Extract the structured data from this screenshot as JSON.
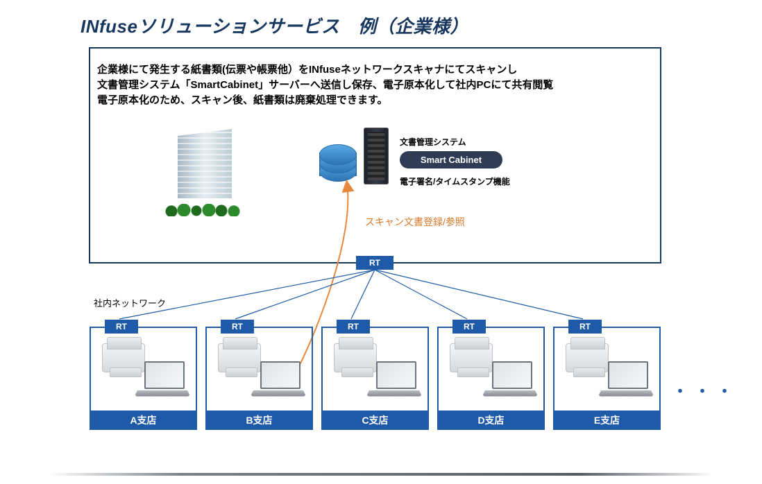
{
  "title": "INfuseソリューションサービス　例（企業様）",
  "description_line1": "企業様にて発生する紙書類(伝票や帳票他）をINfuseネットワークスキャナにてスキャンし",
  "description_line2": "文書管理システム「SmartCabinet」サーバーへ送信し保存、電子原本化して社内PCにて共有閲覧",
  "description_line3": "電子原本化のため、スキャン後、紙書類は廃棄処理できます。",
  "dms_label": "文書管理システム",
  "badge": "Smart Cabinet",
  "signature_label": "電子署名/タイムスタンプ機能",
  "scan_label": "スキャン文書登録/参照",
  "rt_label": "RT",
  "network_label": "社内ネットワーク",
  "branches": [
    {
      "rt": "RT",
      "name": "A支店"
    },
    {
      "rt": "RT",
      "name": "B支店"
    },
    {
      "rt": "RT",
      "name": "C支店"
    },
    {
      "rt": "RT",
      "name": "D支店"
    },
    {
      "rt": "RT",
      "name": "E支店"
    }
  ],
  "ellipsis": "・・・",
  "colors": {
    "brand_navy": "#17375e",
    "brand_blue": "#1e5aa8",
    "arrow_orange": "#E8883B"
  }
}
